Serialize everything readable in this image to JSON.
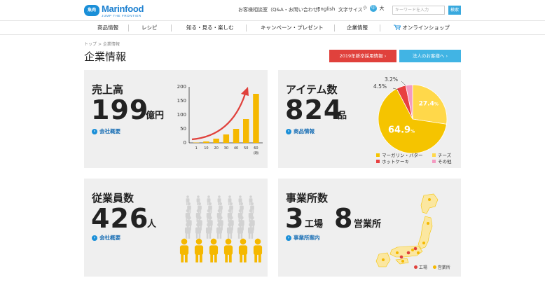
{
  "header": {
    "logo_badge": "魚肉",
    "logo_name": "Marinfood",
    "logo_tagline": "JUMP THE FRONTIER",
    "links": [
      "お客様相談室（Q&A・お問い合わせ）",
      "English",
      "文字サイズ"
    ],
    "font_sizes": [
      "小",
      "中",
      "大"
    ],
    "search_placeholder": "キーワードを入力",
    "search_button": "検索"
  },
  "nav": {
    "items": [
      "商品情報",
      "レシピ",
      "知る・見る・楽しむ",
      "キャンペーン・プレゼント",
      "企業情報",
      "オンラインショップ"
    ]
  },
  "breadcrumb": {
    "home": "トップ",
    "sep": ">",
    "current": "企業情報"
  },
  "page_title": "企業情報",
  "buttons": {
    "recruit": "2019年新卒採用情報 ›",
    "corporate": "法人のお客様へ ›"
  },
  "cards": {
    "sales": {
      "title": "売上高",
      "value": "199",
      "unit": "億円",
      "link": "会社概要"
    },
    "items": {
      "title": "アイテム数",
      "value": "824",
      "unit": "品",
      "link": "商品情報"
    },
    "employees": {
      "title": "従業員数",
      "value": "426",
      "unit": "人",
      "link": "会社概要"
    },
    "offices": {
      "title": "事業所数",
      "value1": "3",
      "unit1": "工場",
      "value2": "8",
      "unit2": "営業所",
      "link": "事業所案内"
    }
  },
  "chart_data": [
    {
      "type": "bar",
      "categories": [
        "1",
        "10",
        "20",
        "30",
        "40",
        "50",
        "60"
      ],
      "x_unit": "(期)",
      "values": [
        1,
        5,
        15,
        30,
        50,
        85,
        175
      ],
      "yticks": [
        "0",
        "50",
        "100",
        "150",
        "200"
      ],
      "ylim": [
        0,
        200
      ],
      "color": "#f5b800",
      "arrow_color": "#e0413c"
    },
    {
      "type": "pie",
      "slices": [
        {
          "label": "マーガリン・バター",
          "value": 64.9,
          "color": "#f5c400"
        },
        {
          "label": "チーズ",
          "value": 27.4,
          "color": "#ffd84a"
        },
        {
          "label": "ホットケーキ",
          "value": 4.5,
          "color": "#e84040"
        },
        {
          "label": "その他",
          "value": 3.2,
          "color": "#f49ac1"
        }
      ],
      "labels": [
        "64.9",
        "27.4",
        "4.5",
        "3.2"
      ],
      "percent_sign": "%"
    }
  ],
  "map_legend": {
    "factory": "工場",
    "office": "営業所",
    "factory_color": "#e0413c",
    "office_color": "#f5b800"
  },
  "colors": {
    "accent_blue": "#1a8fd8",
    "red": "#e0413c",
    "yellow": "#f5b800"
  }
}
